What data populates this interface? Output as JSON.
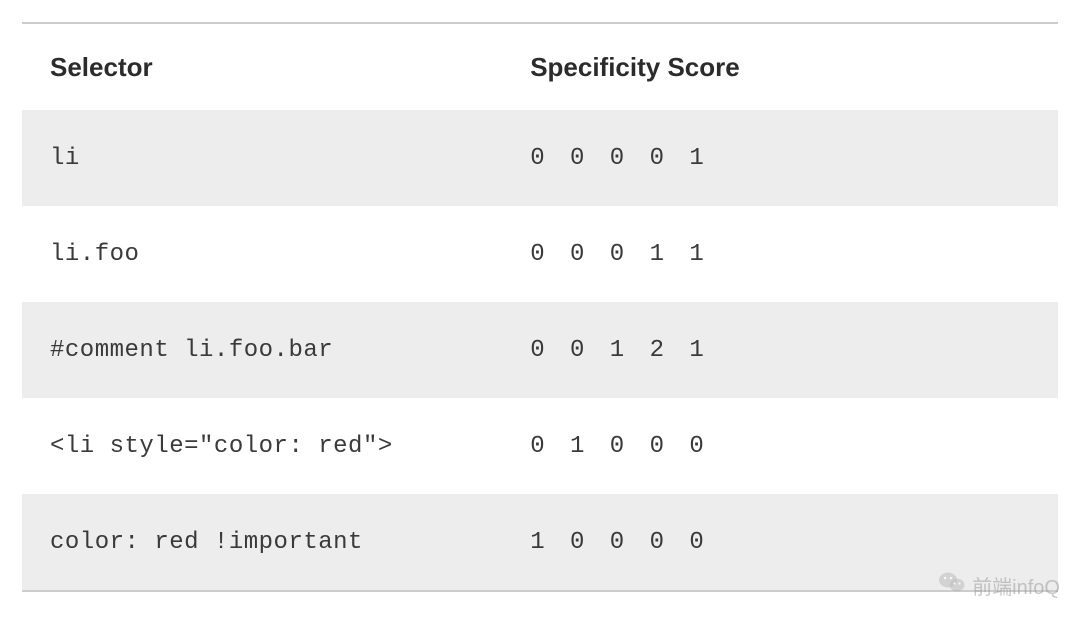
{
  "table": {
    "headers": {
      "selector": "Selector",
      "score": "Specificity Score"
    },
    "rows": [
      {
        "selector": "li",
        "score": "0 0 0 0 1"
      },
      {
        "selector": "li.foo",
        "score": "0 0 0 1 1"
      },
      {
        "selector": "#comment li.foo.bar",
        "score": "0 0 1 2 1"
      },
      {
        "selector": "<li style=\"color: red\">",
        "score": "0 1 0 0 0"
      },
      {
        "selector": "color: red !important",
        "score": "1 0 0 0 0"
      }
    ]
  },
  "watermark": {
    "text": "前端infoQ"
  }
}
